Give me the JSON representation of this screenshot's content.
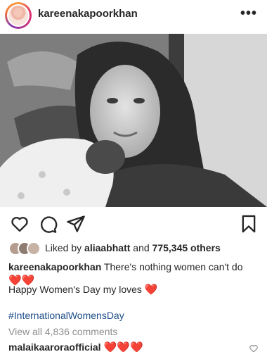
{
  "header": {
    "username": "kareenakapoorkhan",
    "more_icon": "more-horizontal-icon"
  },
  "photo": {
    "description_icon": "post-photo"
  },
  "actions": {
    "like_icon": "heart-outline-icon",
    "comment_icon": "comment-bubble-icon",
    "share_icon": "paper-plane-icon",
    "save_icon": "bookmark-icon"
  },
  "likes": {
    "prefix": "Liked by ",
    "user": "aliaabhatt",
    "middle": " and ",
    "count_text": "775,345 others"
  },
  "caption": {
    "author": "kareenakapoorkhan",
    "text": " There's nothing women can't do ",
    "hearts_1": "❤️❤️",
    "line2": "Happy Women's Day my loves ",
    "heart_2": "❤️",
    "hashtag": "#InternationalWomensDay"
  },
  "comments": {
    "view_all": "View all 4,836 comments",
    "first_author": "malaikaaroraofficial",
    "first_text": " ❤️❤️❤️"
  },
  "colors": {
    "text": "#262626",
    "muted": "#8e8e8e",
    "link": "#1d4e89",
    "heart": "#e0245e"
  }
}
